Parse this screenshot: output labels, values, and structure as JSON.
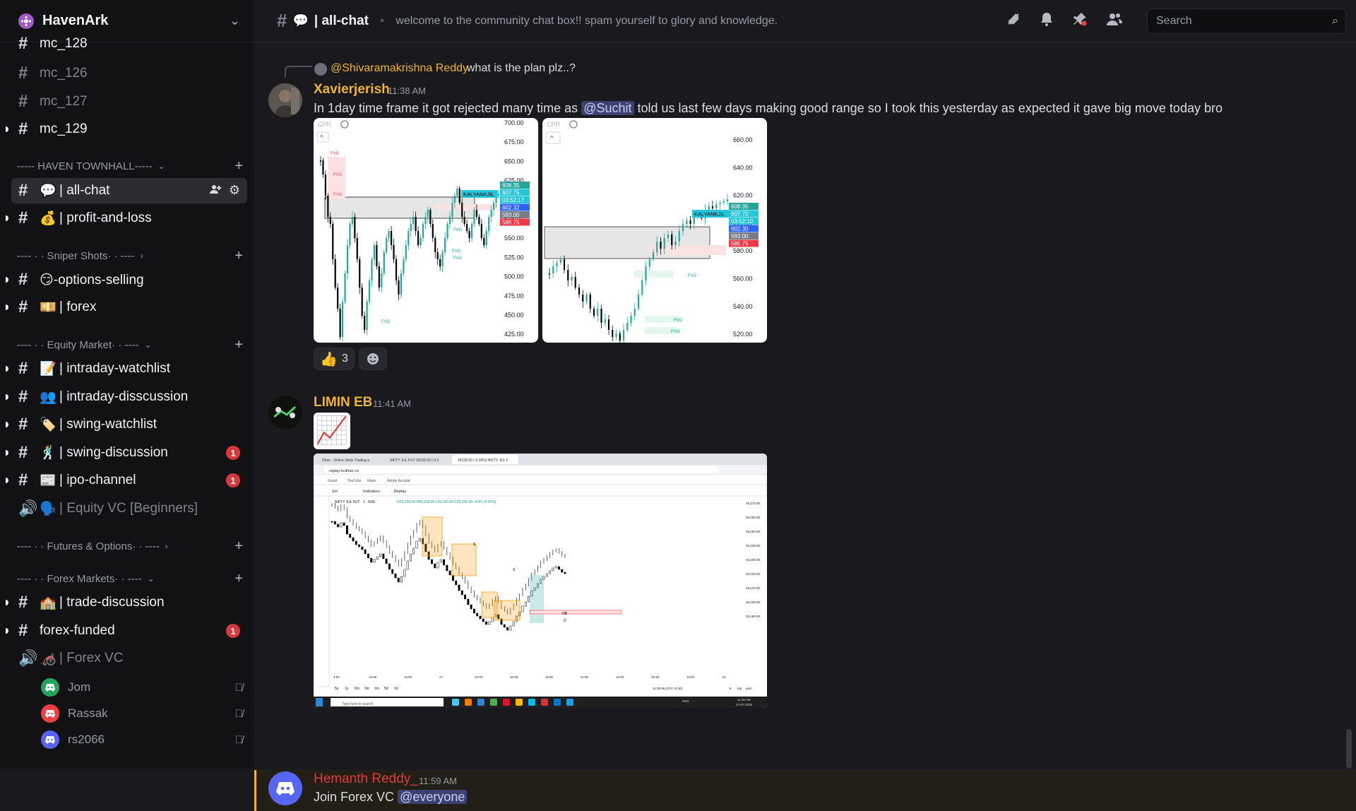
{
  "server": {
    "name": "HavenArk"
  },
  "sidebar": {
    "channels_top": [
      {
        "name": "mc_128",
        "bold": true
      },
      {
        "name": "mc_126",
        "bold": false
      },
      {
        "name": "mc_127",
        "bold": false
      },
      {
        "name": "mc_129",
        "bold": true
      }
    ],
    "cat_townhall": "----- HAVEN TOWNHALL-----",
    "all_chat": {
      "emoji": "💬",
      "name": "| all-chat"
    },
    "profit": {
      "emoji": "💰",
      "name": "| profit-and-loss"
    },
    "cat_sniper": "---- · · Sniper Shots· · ----",
    "options": {
      "name": "😏-options-selling"
    },
    "forex": {
      "emoji": "💴",
      "name": "| forex"
    },
    "cat_equity": "---- · · Equity Market· · ----",
    "equity_channels": [
      {
        "emoji": "📝",
        "name": "| intraday-watchlist",
        "badge": ""
      },
      {
        "emoji": "👥",
        "name": "| intraday-disscussion",
        "badge": ""
      },
      {
        "emoji": "🏷️",
        "name": "| swing-watchlist",
        "badge": ""
      },
      {
        "emoji": "🕺",
        "name": "| swing-discussion",
        "badge": "1"
      },
      {
        "emoji": "📰",
        "name": "| ipo-channel",
        "badge": "1"
      }
    ],
    "equity_vc": {
      "emoji": "🗣️",
      "name": "| Equity VC [Beginners]"
    },
    "cat_fno": "---- · · Futures & Options· · ----",
    "cat_forex": "---- · · Forex Markets· · ----",
    "trade_discussion": {
      "emoji": "🏫",
      "name": "| trade-discussion"
    },
    "forex_funded": {
      "name": "forex-funded",
      "badge": "1"
    },
    "forex_vc": {
      "emoji": "🦽",
      "name": "| Forex VC"
    },
    "vc_users": [
      {
        "name": "Jom",
        "color": "#23a55a"
      },
      {
        "name": "Rassak",
        "color": "#f23f43"
      },
      {
        "name": "rs2066",
        "color": "#5865f2"
      }
    ]
  },
  "topbar": {
    "emoji": "💬",
    "channel": "| all-chat",
    "topic": "welcome to the community chat box!! spam yourself to glory and knowledge."
  },
  "search": {
    "placeholder": "Search"
  },
  "messages": {
    "m1": {
      "reply_author": "@Shivaramakrishna Reddy",
      "reply_text": "what is the plan plz..?",
      "author": "Xavierjerish",
      "time": "11:38 AM",
      "text_a": "In 1day time frame it got rejected many time as",
      "mention": "@Suchit",
      "text_b": "told us last few days making good range so I took this yesterday as expected it gave big move today bro",
      "reaction_emoji": "👍",
      "reaction_count": "3"
    },
    "m2": {
      "author": "LIMIN EB",
      "time": "11:41 AM",
      "emoji": "📈"
    },
    "m3": {
      "author": "Hemanth Reddy_",
      "time": "11:59 AM",
      "text": "Join Forex VC",
      "mention": "@everyone"
    }
  },
  "chart_left": {
    "cpr": "CPR",
    "ticks": [
      "700.00",
      "675.00",
      "650.00",
      "625.00",
      "600.00",
      "575.00",
      "550.00",
      "525.00",
      "500.00",
      "475.00",
      "450.00",
      "425.00"
    ],
    "label": "KALYANKJIL",
    "prices": [
      {
        "text": "608.35",
        "color": "#26a69a"
      },
      {
        "text": "607.75",
        "color": "#26c6da"
      },
      {
        "text": "03:52:17",
        "color": "#26c6da"
      },
      {
        "text": "602.32",
        "color": "#2962ff"
      },
      {
        "text": "593.00",
        "color": "#787b86"
      },
      {
        "text": "586.75",
        "color": "#f23645"
      }
    ],
    "fvg": "FVG"
  },
  "chart_right": {
    "cpr": "CPR",
    "ticks": [
      "660.00",
      "640.00",
      "620.00",
      "600.00",
      "580.00",
      "560.00",
      "540.00",
      "520.00"
    ],
    "label": "KALYANKJIL",
    "prices": [
      {
        "text": "608.35",
        "color": "#26a69a"
      },
      {
        "text": "607.70",
        "color": "#26c6da"
      },
      {
        "text": "03:52:10",
        "color": "#26c6da"
      },
      {
        "text": "602.30",
        "color": "#2962ff"
      },
      {
        "text": "593.00",
        "color": "#787b86"
      },
      {
        "text": "586.75",
        "color": "#f23645"
      }
    ],
    "fvg": "FVG"
  },
  "screenshot": {
    "tabs": [
      "Dhan - Online Stock Trading a",
      "NIFTY JUL FUT 25228.00 (-0.0",
      "25228.00 (-0.00%) NIFTY JUL F"
    ],
    "url": "replay-tv.dhan.co",
    "bookmarks": [
      "Gmail",
      "YouTube",
      "Maps",
      "Adobe Acrobat"
    ],
    "toolbar": [
      "1m",
      "Indicators",
      "Replay"
    ],
    "symbol": "NIFTY JUL FUT · 1 · NSE",
    "ohlc": "O25,228.00 H25,228.00 L25,226.00 C25,226.00 -4.00 (-0.02%)",
    "price_ticks": [
      "25,270.00",
      "25,260.00",
      "25,250.00",
      "25,240.00",
      "25,230.00",
      "25,220.00",
      "25,210.00",
      "25,200.00",
      "25,190.00"
    ],
    "time_ticks": [
      "4:00",
      "14:30",
      "15:00",
      "17",
      "10:00",
      "10:30",
      "11:00",
      "11:30",
      "12:00",
      "12:30",
      "13:00",
      "13:"
    ],
    "ranges": [
      "5y",
      "1y",
      "6m",
      "3m",
      "1m",
      "5d",
      "1d"
    ],
    "status": "11:35:05 (UTC+5:30)",
    "status_right": [
      "%",
      "log",
      "auto"
    ],
    "taskbar_search": "Type here to search",
    "clock": "11:35 AM",
    "date": "17-07-2025",
    "lang": "ENG",
    "ob": "OB",
    "s": "S",
    "d": "D"
  },
  "colors": {
    "accent": "#f0b232",
    "author_yellow": "#f0b232",
    "author_red": "#e03c3c",
    "mention_bg": "#3c4270"
  }
}
